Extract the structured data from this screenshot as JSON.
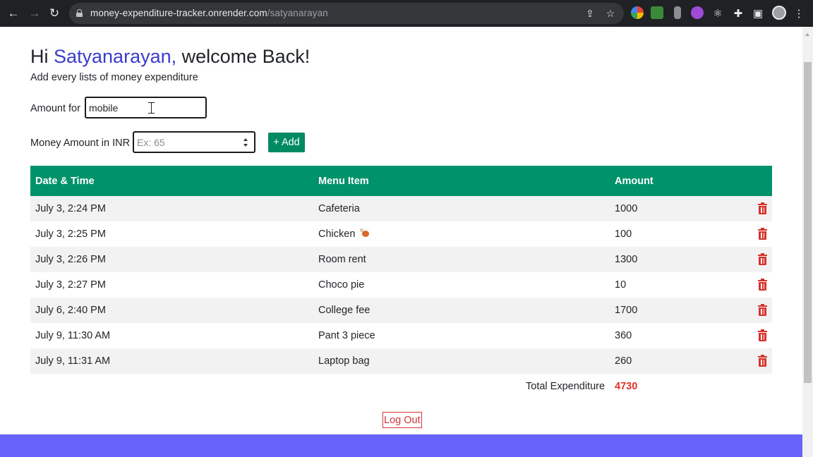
{
  "browser": {
    "url_host": "money-expenditure-tracker.onrender.com",
    "url_path": "/satyanarayan",
    "icons": [
      "back-icon",
      "forward-icon",
      "reload-icon",
      "lock-icon",
      "share-icon",
      "star-icon",
      "extensions-icon",
      "side-panel-icon",
      "profile-avatar",
      "menu-icon"
    ]
  },
  "header": {
    "greeting_prefix": "Hi ",
    "user_name": "Satyanarayan,",
    "greeting_suffix": " welcome Back!",
    "subtitle": "Add every lists of money expenditure"
  },
  "form": {
    "item_label": "Amount for",
    "item_value": "mobile",
    "amount_label": "Money Amount in INR",
    "amount_placeholder": "Ex: 65",
    "add_label": "+ Add"
  },
  "table": {
    "headers": [
      "Date & Time",
      "Menu Item",
      "Amount"
    ],
    "rows": [
      {
        "datetime": "July 3, 2:24 PM",
        "item": "Cafeteria",
        "amount": "1000"
      },
      {
        "datetime": "July 3, 2:25 PM",
        "item": "Chicken",
        "amount": "100"
      },
      {
        "datetime": "July 3, 2:26 PM",
        "item": "Room rent",
        "amount": "1300"
      },
      {
        "datetime": "July 3, 2:27 PM",
        "item": "Choco pie",
        "amount": "10"
      },
      {
        "datetime": "July 6, 2:40 PM",
        "item": "College fee",
        "amount": "1700"
      },
      {
        "datetime": "July 9, 11:30 AM",
        "item": "Pant 3 piece",
        "amount": "360"
      },
      {
        "datetime": "July 9, 11:31 AM",
        "item": "Laptop bag",
        "amount": "260"
      }
    ],
    "total_label": "Total Expenditure",
    "total_value": "4730"
  },
  "logout_label": "Log Out",
  "colors": {
    "header_green": "#00926a",
    "add_button": "#008a63",
    "name_blue": "#3a3ccc",
    "total_red": "#e0332a",
    "delete_red": "#d6312b",
    "footer": "#6563fa"
  }
}
